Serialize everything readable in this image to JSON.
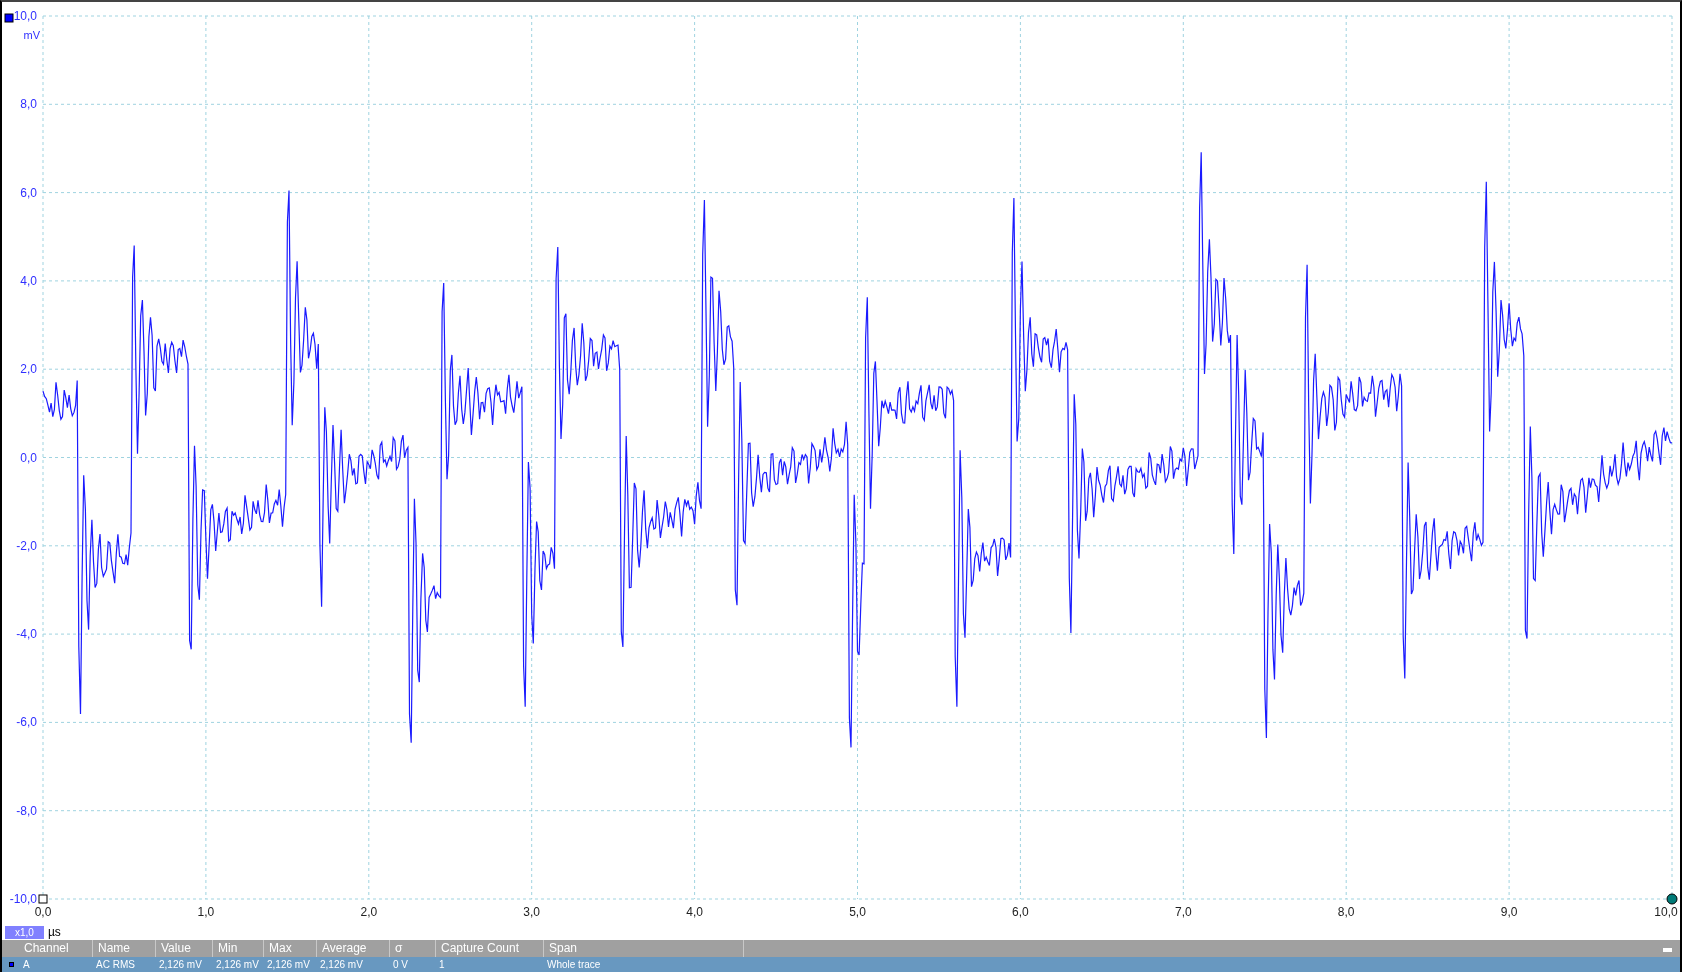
{
  "y_axis": {
    "unit": "mV",
    "ticks": [
      "10,0",
      "8,0",
      "6,0",
      "4,0",
      "2,0",
      "0,0",
      "-2,0",
      "-4,0",
      "-6,0",
      "-8,0",
      "-10,0"
    ]
  },
  "x_axis": {
    "ticks": [
      "0,0",
      "1,0",
      "2,0",
      "3,0",
      "4,0",
      "5,0",
      "6,0",
      "7,0",
      "8,0",
      "9,0",
      "10,0"
    ],
    "zoom": "x1,0",
    "unit": "µs"
  },
  "measurements": {
    "columns": [
      "Channel",
      "Name",
      "Value",
      "Min",
      "Max",
      "Average",
      "σ",
      "Capture Count",
      "Span"
    ],
    "rows": [
      {
        "selected": true,
        "cells": [
          "A",
          "AC RMS",
          "2,126 mV",
          "2,126 mV",
          "2,126 mV",
          "2,126 mV",
          "0 V",
          "1",
          "Whole trace"
        ]
      }
    ]
  }
}
